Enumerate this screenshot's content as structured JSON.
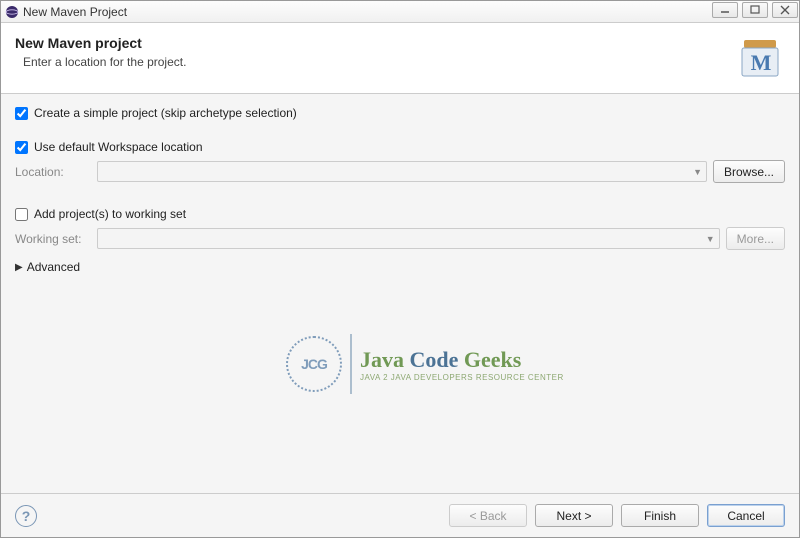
{
  "window": {
    "title": "New Maven Project"
  },
  "banner": {
    "title": "New Maven project",
    "description": "Enter a location for the project.",
    "icon": "maven-box-icon"
  },
  "form": {
    "simple_project": {
      "checked": true,
      "label": "Create a simple project (skip archetype selection)"
    },
    "use_default_loc": {
      "checked": true,
      "label": "Use default Workspace location"
    },
    "location": {
      "label": "Location:",
      "value": ""
    },
    "browse_btn": "Browse...",
    "add_working_set": {
      "checked": false,
      "label": "Add project(s) to working set"
    },
    "working_set": {
      "label": "Working set:",
      "value": ""
    },
    "more_btn": "More...",
    "advanced_label": "Advanced"
  },
  "footer": {
    "back": "< Back",
    "next": "Next >",
    "finish": "Finish",
    "cancel": "Cancel"
  },
  "watermark": {
    "badge": "JCG",
    "title_a": "Java",
    "title_b": "Code",
    "title_c": "Geeks",
    "subtitle": "Java 2 Java Developers Resource Center"
  }
}
